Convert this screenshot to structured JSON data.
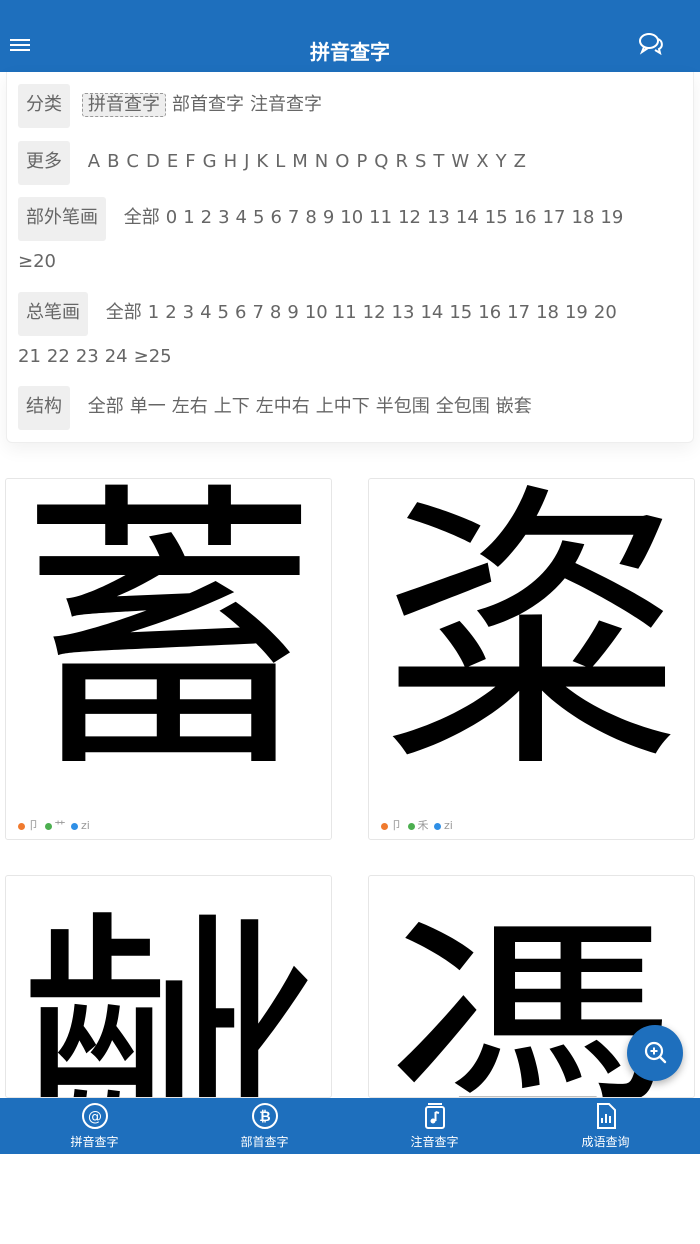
{
  "header": {
    "title": "拼音查字"
  },
  "filters": {
    "category": {
      "label": "分类",
      "options": [
        "拼音查字",
        "部首查字",
        "注音查字"
      ],
      "selected": "拼音查字"
    },
    "more": {
      "label": "更多",
      "letters": [
        "A",
        "B",
        "C",
        "D",
        "E",
        "F",
        "G",
        "H",
        "J",
        "K",
        "L",
        "M",
        "N",
        "O",
        "P",
        "Q",
        "R",
        "S",
        "T",
        "W",
        "X",
        "Y",
        "Z"
      ]
    },
    "radical_strokes": {
      "label": "部外笔画",
      "options": [
        "全部",
        "0",
        "1",
        "2",
        "3",
        "4",
        "5",
        "6",
        "7",
        "8",
        "9",
        "10",
        "11",
        "12",
        "13",
        "14",
        "15",
        "16",
        "17",
        "18",
        "19",
        "≥20"
      ]
    },
    "total_strokes": {
      "label": "总笔画",
      "options": [
        "全部",
        "1",
        "2",
        "3",
        "4",
        "5",
        "6",
        "7",
        "8",
        "9",
        "10",
        "11",
        "12",
        "13",
        "14",
        "15",
        "16",
        "17",
        "18",
        "19",
        "20",
        "21",
        "22",
        "23",
        "24",
        "≥25"
      ]
    },
    "structure": {
      "label": "结构",
      "options": [
        "全部",
        "单一",
        "左右",
        "上下",
        "左中右",
        "上中下",
        "半包围",
        "全包围",
        "嵌套"
      ]
    }
  },
  "cards": [
    {
      "char": "蓄",
      "radical": "卩",
      "radical2": "艹",
      "pinyin": "zi"
    },
    {
      "char": "粢",
      "radical": "卩",
      "radical2": "禾",
      "pinyin": "zi"
    },
    {
      "char": "齜",
      "radical": "",
      "radical2": "",
      "pinyin": ""
    },
    {
      "char": "凴",
      "radical": "",
      "radical2": "",
      "pinyin": ""
    }
  ],
  "bottom_nav": [
    {
      "label": "拼音查字",
      "icon": "at-icon"
    },
    {
      "label": "部首查字",
      "icon": "bitcoin-icon"
    },
    {
      "label": "注音查字",
      "icon": "music-note-icon"
    },
    {
      "label": "成语查询",
      "icon": "chart-file-icon"
    }
  ],
  "colors": {
    "brand": "#1e6fbd",
    "dot_orange": "#f07a2e",
    "dot_green": "#4caf50",
    "dot_blue": "#2f8fe6"
  }
}
